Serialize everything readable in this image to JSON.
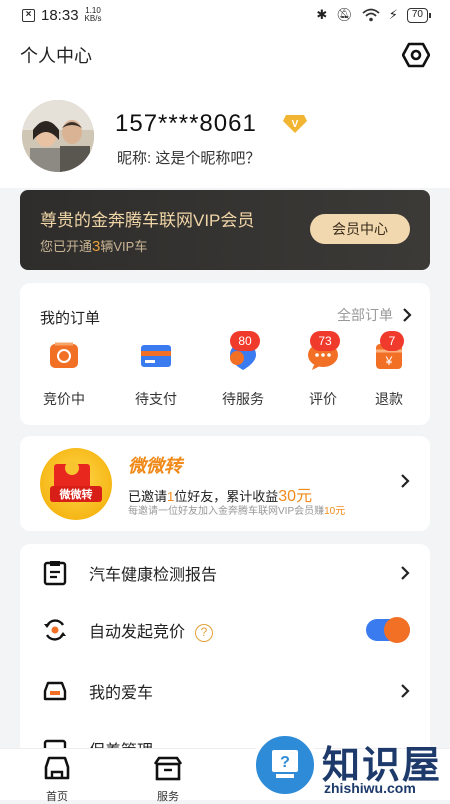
{
  "status_bar": {
    "time": "18:33",
    "speed_value": "1.10",
    "speed_unit": "KB/s",
    "battery": "70"
  },
  "header": {
    "title": "个人中心"
  },
  "profile": {
    "phone": "157****8061",
    "nickname": "昵称: 这是个昵称吧？",
    "vip_badge": "V"
  },
  "vip": {
    "title": "尊贵的金奔腾车联网VIP会员",
    "subtitle_pre": "您已开通",
    "subtitle_count": "3",
    "subtitle_post": "辆VIP车",
    "button": "会员中心"
  },
  "orders": {
    "title": "我的订单",
    "all": "全部订单",
    "items": [
      {
        "label": "竞价中",
        "badge": ""
      },
      {
        "label": "待支付",
        "badge": ""
      },
      {
        "label": "待服务",
        "badge": "80"
      },
      {
        "label": "评价",
        "badge": "73"
      },
      {
        "label": "退款",
        "badge": "7"
      }
    ]
  },
  "invite": {
    "logo_text": "微微转",
    "title": "微微转",
    "line_pre": "已邀请",
    "friends": "1",
    "line_mid": "位好友，累计收益",
    "earnings": "30元",
    "sub_pre": "每邀请一位好友加入金奔腾车联网VIP会员赚",
    "sub_amount": "10元"
  },
  "menu": {
    "items": [
      {
        "label": "汽车健康检测报告"
      },
      {
        "label": "自动发起竞价"
      },
      {
        "label": "我的爱车"
      },
      {
        "label": "保养管理"
      }
    ]
  },
  "tabbar": {
    "items": [
      {
        "label": "首页"
      },
      {
        "label": "服务"
      }
    ]
  },
  "watermark": {
    "title": "知识屋",
    "url": "zhishiwu.com"
  },
  "colors": {
    "accent_orange": "#f27026",
    "badge_red": "#f03a2c",
    "gold": "#f0d5a7"
  }
}
